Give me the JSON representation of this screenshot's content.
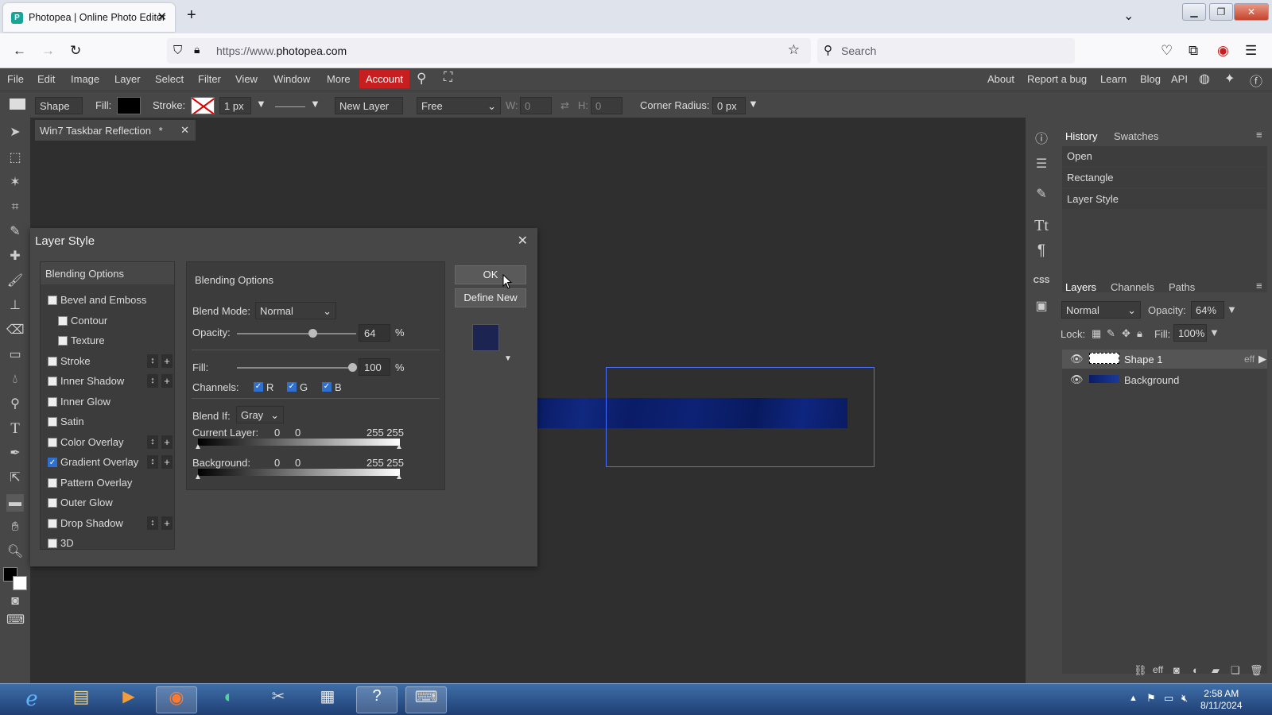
{
  "browser": {
    "tab_title": "Photopea | Online Photo Editor",
    "url_prefix": "https://www.",
    "url_domain": "photopea.com",
    "search_placeholder": "Search"
  },
  "menubar": {
    "items": [
      "File",
      "Edit",
      "Image",
      "Layer",
      "Select",
      "Filter",
      "View",
      "Window",
      "More"
    ],
    "account": "Account",
    "right_links": [
      "About",
      "Report a bug",
      "Learn",
      "Blog",
      "API"
    ]
  },
  "options": {
    "mode": "Shape",
    "fill_label": "Fill:",
    "stroke_label": "Stroke:",
    "stroke_width": "1 px",
    "layer_mode": "New Layer",
    "constraint": "Free",
    "w_label": "W:",
    "w_value": "0",
    "h_label": "H:",
    "h_value": "0",
    "corner_label": "Corner Radius:",
    "corner_value": "0 px"
  },
  "document": {
    "tab_title": "Win7 Taskbar Reflection",
    "modified": "*"
  },
  "history": {
    "tabs": [
      "History",
      "Swatches"
    ],
    "items": [
      "Open",
      "Rectangle",
      "Layer Style"
    ]
  },
  "layers": {
    "tabs": [
      "Layers",
      "Channels",
      "Paths"
    ],
    "blend_mode": "Normal",
    "opacity_label": "Opacity:",
    "opacity": "64%",
    "lock_label": "Lock:",
    "fill_label": "Fill:",
    "fill": "100%",
    "items": [
      {
        "name": "Shape 1",
        "effects": "eff"
      },
      {
        "name": "Background",
        "effects": ""
      }
    ]
  },
  "dialog": {
    "title": "Layer Style",
    "list_header": "Blending Options",
    "styles": [
      {
        "label": "Bevel and Emboss",
        "checked": false,
        "indent": false,
        "controls": false
      },
      {
        "label": "Contour",
        "checked": false,
        "indent": true,
        "controls": false
      },
      {
        "label": "Texture",
        "checked": false,
        "indent": true,
        "controls": false
      },
      {
        "label": "Stroke",
        "checked": false,
        "indent": false,
        "controls": true
      },
      {
        "label": "Inner Shadow",
        "checked": false,
        "indent": false,
        "controls": true
      },
      {
        "label": "Inner Glow",
        "checked": false,
        "indent": false,
        "controls": false
      },
      {
        "label": "Satin",
        "checked": false,
        "indent": false,
        "controls": false
      },
      {
        "label": "Color Overlay",
        "checked": false,
        "indent": false,
        "controls": true
      },
      {
        "label": "Gradient Overlay",
        "checked": true,
        "indent": false,
        "controls": true
      },
      {
        "label": "Pattern Overlay",
        "checked": false,
        "indent": false,
        "controls": false
      },
      {
        "label": "Outer Glow",
        "checked": false,
        "indent": false,
        "controls": false
      },
      {
        "label": "Drop Shadow",
        "checked": false,
        "indent": false,
        "controls": true
      },
      {
        "label": "3D",
        "checked": false,
        "indent": false,
        "controls": false
      }
    ],
    "panel_title": "Blending Options",
    "blend_mode_label": "Blend Mode:",
    "blend_mode": "Normal",
    "opacity_label": "Opacity:",
    "opacity": "64",
    "fill_label": "Fill:",
    "fill": "100",
    "percent": "%",
    "channels_label": "Channels:",
    "channels": [
      "R",
      "G",
      "B"
    ],
    "blend_if_label": "Blend If:",
    "blend_if": "Gray",
    "current_layer_label": "Current Layer:",
    "current_layer_values": [
      "0",
      "0",
      "255 255"
    ],
    "background_label": "Background:",
    "background_values": [
      "0",
      "0",
      "255 255"
    ],
    "ok": "OK",
    "define_new": "Define New",
    "preview_color": "#1c2452"
  },
  "taskbar": {
    "time": "2:58 AM",
    "date": "8/11/2024"
  },
  "colors": {
    "accent_red": "#c71f1f",
    "selection_blue": "#4a6fff",
    "shape_blue": "#0a1c66"
  }
}
